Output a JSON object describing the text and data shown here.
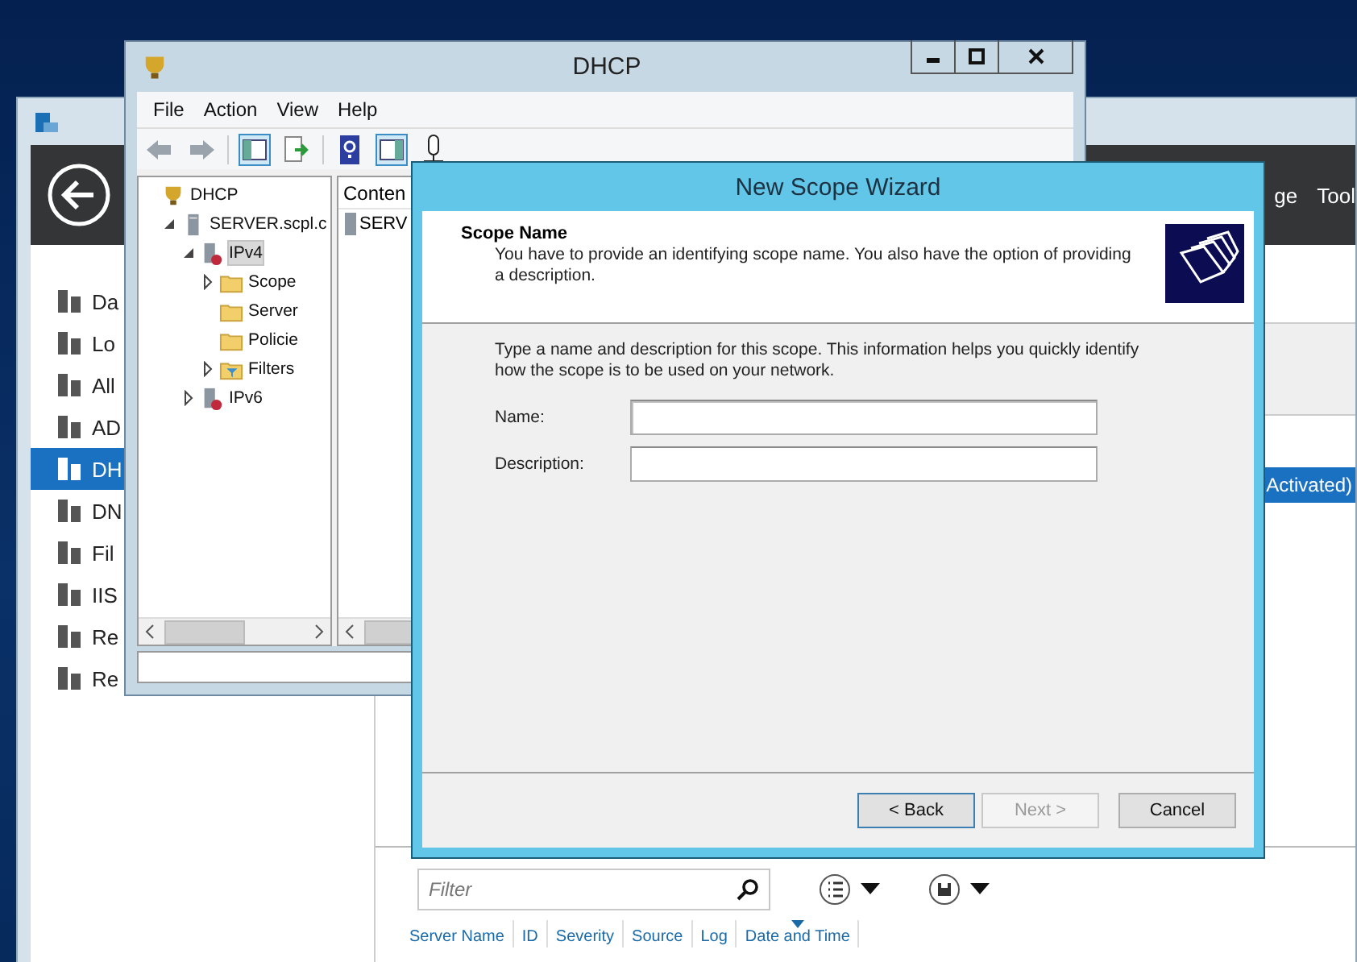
{
  "server_manager": {
    "header_menu": [
      "ge",
      "Tool"
    ],
    "sidebar": {
      "items": [
        {
          "label": "Da",
          "selected": false
        },
        {
          "label": "Lo",
          "selected": false
        },
        {
          "label": "All",
          "selected": false
        },
        {
          "label": "AD",
          "selected": false
        },
        {
          "label": "DH",
          "selected": true
        },
        {
          "label": "DN",
          "selected": false
        },
        {
          "label": "Fil",
          "selected": false
        },
        {
          "label": "IIS",
          "selected": false
        },
        {
          "label": "Re",
          "selected": false
        },
        {
          "label": "Re",
          "selected": false
        }
      ]
    },
    "content": {
      "rows": [
        {
          "text": "Activated)",
          "selected": true
        }
      ],
      "filter": {
        "placeholder": "Filter"
      },
      "columns": [
        {
          "label": "Server Name",
          "sorted": false
        },
        {
          "label": "ID",
          "sorted": false
        },
        {
          "label": "Severity",
          "sorted": false
        },
        {
          "label": "Source",
          "sorted": false
        },
        {
          "label": "Log",
          "sorted": false
        },
        {
          "label": "Date and Time",
          "sorted": true
        }
      ]
    }
  },
  "dhcp_window": {
    "title": "DHCP",
    "menu": [
      "File",
      "Action",
      "View",
      "Help"
    ],
    "tree": [
      {
        "label": "DHCP",
        "kind": "dhcp",
        "selected": false,
        "children": [
          {
            "label": "SERVER.scpl.c",
            "kind": "server",
            "expanded": true,
            "selected": false,
            "children": [
              {
                "label": "IPv4",
                "kind": "ip",
                "expanded": true,
                "selected": true,
                "children": [
                  {
                    "label": "Scope",
                    "kind": "folder",
                    "expanded": false,
                    "selected": false
                  },
                  {
                    "label": "Server",
                    "kind": "folder",
                    "selected": false
                  },
                  {
                    "label": "Policie",
                    "kind": "folder",
                    "selected": false
                  },
                  {
                    "label": "Filters",
                    "kind": "filter",
                    "expanded": false,
                    "selected": false
                  }
                ]
              },
              {
                "label": "IPv6",
                "kind": "ip",
                "expanded": false,
                "selected": false
              }
            ]
          }
        ]
      }
    ],
    "content_header": "Conten",
    "content_rows": [
      "SERV"
    ]
  },
  "wizard": {
    "title": "New Scope Wizard",
    "heading": "Scope Name",
    "subtitle": "You have to provide an identifying scope name. You also have the option of providing a description.",
    "instructions": "Type a name and description for this scope. This information helps you quickly identify how the scope is to be used on your network.",
    "fields": [
      {
        "label": "Name:",
        "focused": true
      },
      {
        "label": "Description:",
        "focused": false
      }
    ],
    "buttons": [
      {
        "label": "< Back",
        "default": true,
        "disabled": false
      },
      {
        "label": "Next >",
        "default": false,
        "disabled": true
      },
      {
        "label": "Cancel",
        "default": false,
        "disabled": false
      }
    ]
  }
}
